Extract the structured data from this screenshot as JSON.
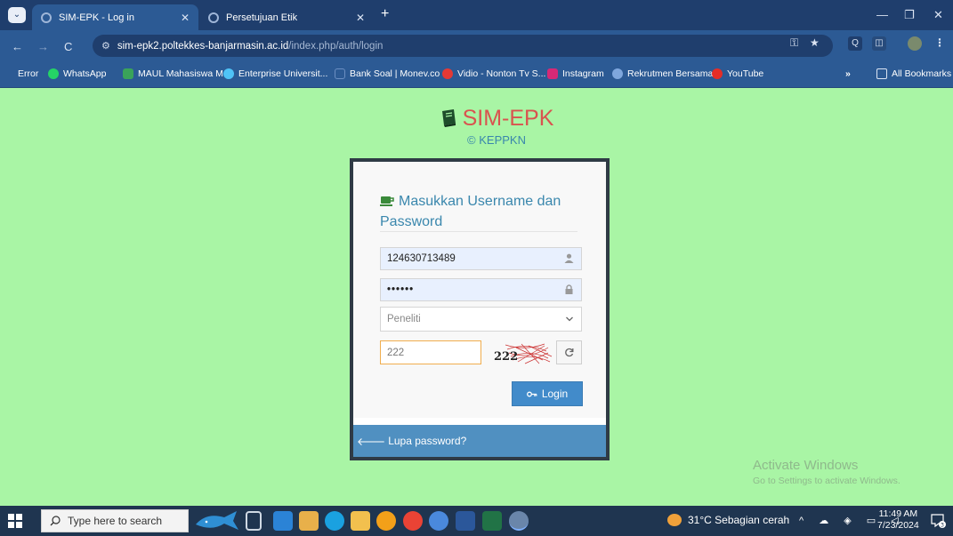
{
  "browser": {
    "tabs": [
      {
        "label": "SIM-EPK - Log in",
        "active": true
      },
      {
        "label": "Persetujuan Etik",
        "active": false
      }
    ],
    "url_host": "sim-epk2.poltekkes-banjarmasin.ac.id",
    "url_path": "/index.php/auth/login",
    "bookmarks": [
      "Error",
      "WhatsApp",
      "MAUL Mahasiswa M...",
      "Enterprise Universit...",
      "Bank Soal | Monev.co",
      "Vidio - Nonton Tv S...",
      "Instagram",
      "Rekrutmen Bersama...",
      "YouTube"
    ],
    "more_bookmarks": "»",
    "all_bookmarks": "All Bookmarks"
  },
  "page": {
    "brand_title": "SIM-EPK",
    "copyright": "© KEPPKN",
    "form_title": "Masukkan Username dan Password",
    "username_value": "124630713489",
    "password_value": "••••••",
    "role_selected": "Peneliti",
    "captcha_value": "222",
    "captcha_text": "222",
    "login_label": "Login",
    "forgot_label": "Lupa password?"
  },
  "watermark": {
    "line1": "Activate Windows",
    "line2": "Go to Settings to activate Windows."
  },
  "taskbar": {
    "search_placeholder": "Type here to search",
    "weather": "31°C  Sebagian cerah",
    "time": "11:49 AM",
    "date": "7/23/2024",
    "notification_count": "3"
  },
  "colors": {
    "page_background": "#a9f5a5",
    "brand_red": "#d9534f",
    "title_blue": "#3a87ad",
    "button_blue": "#428bca",
    "footer_blue": "#5090c1"
  }
}
